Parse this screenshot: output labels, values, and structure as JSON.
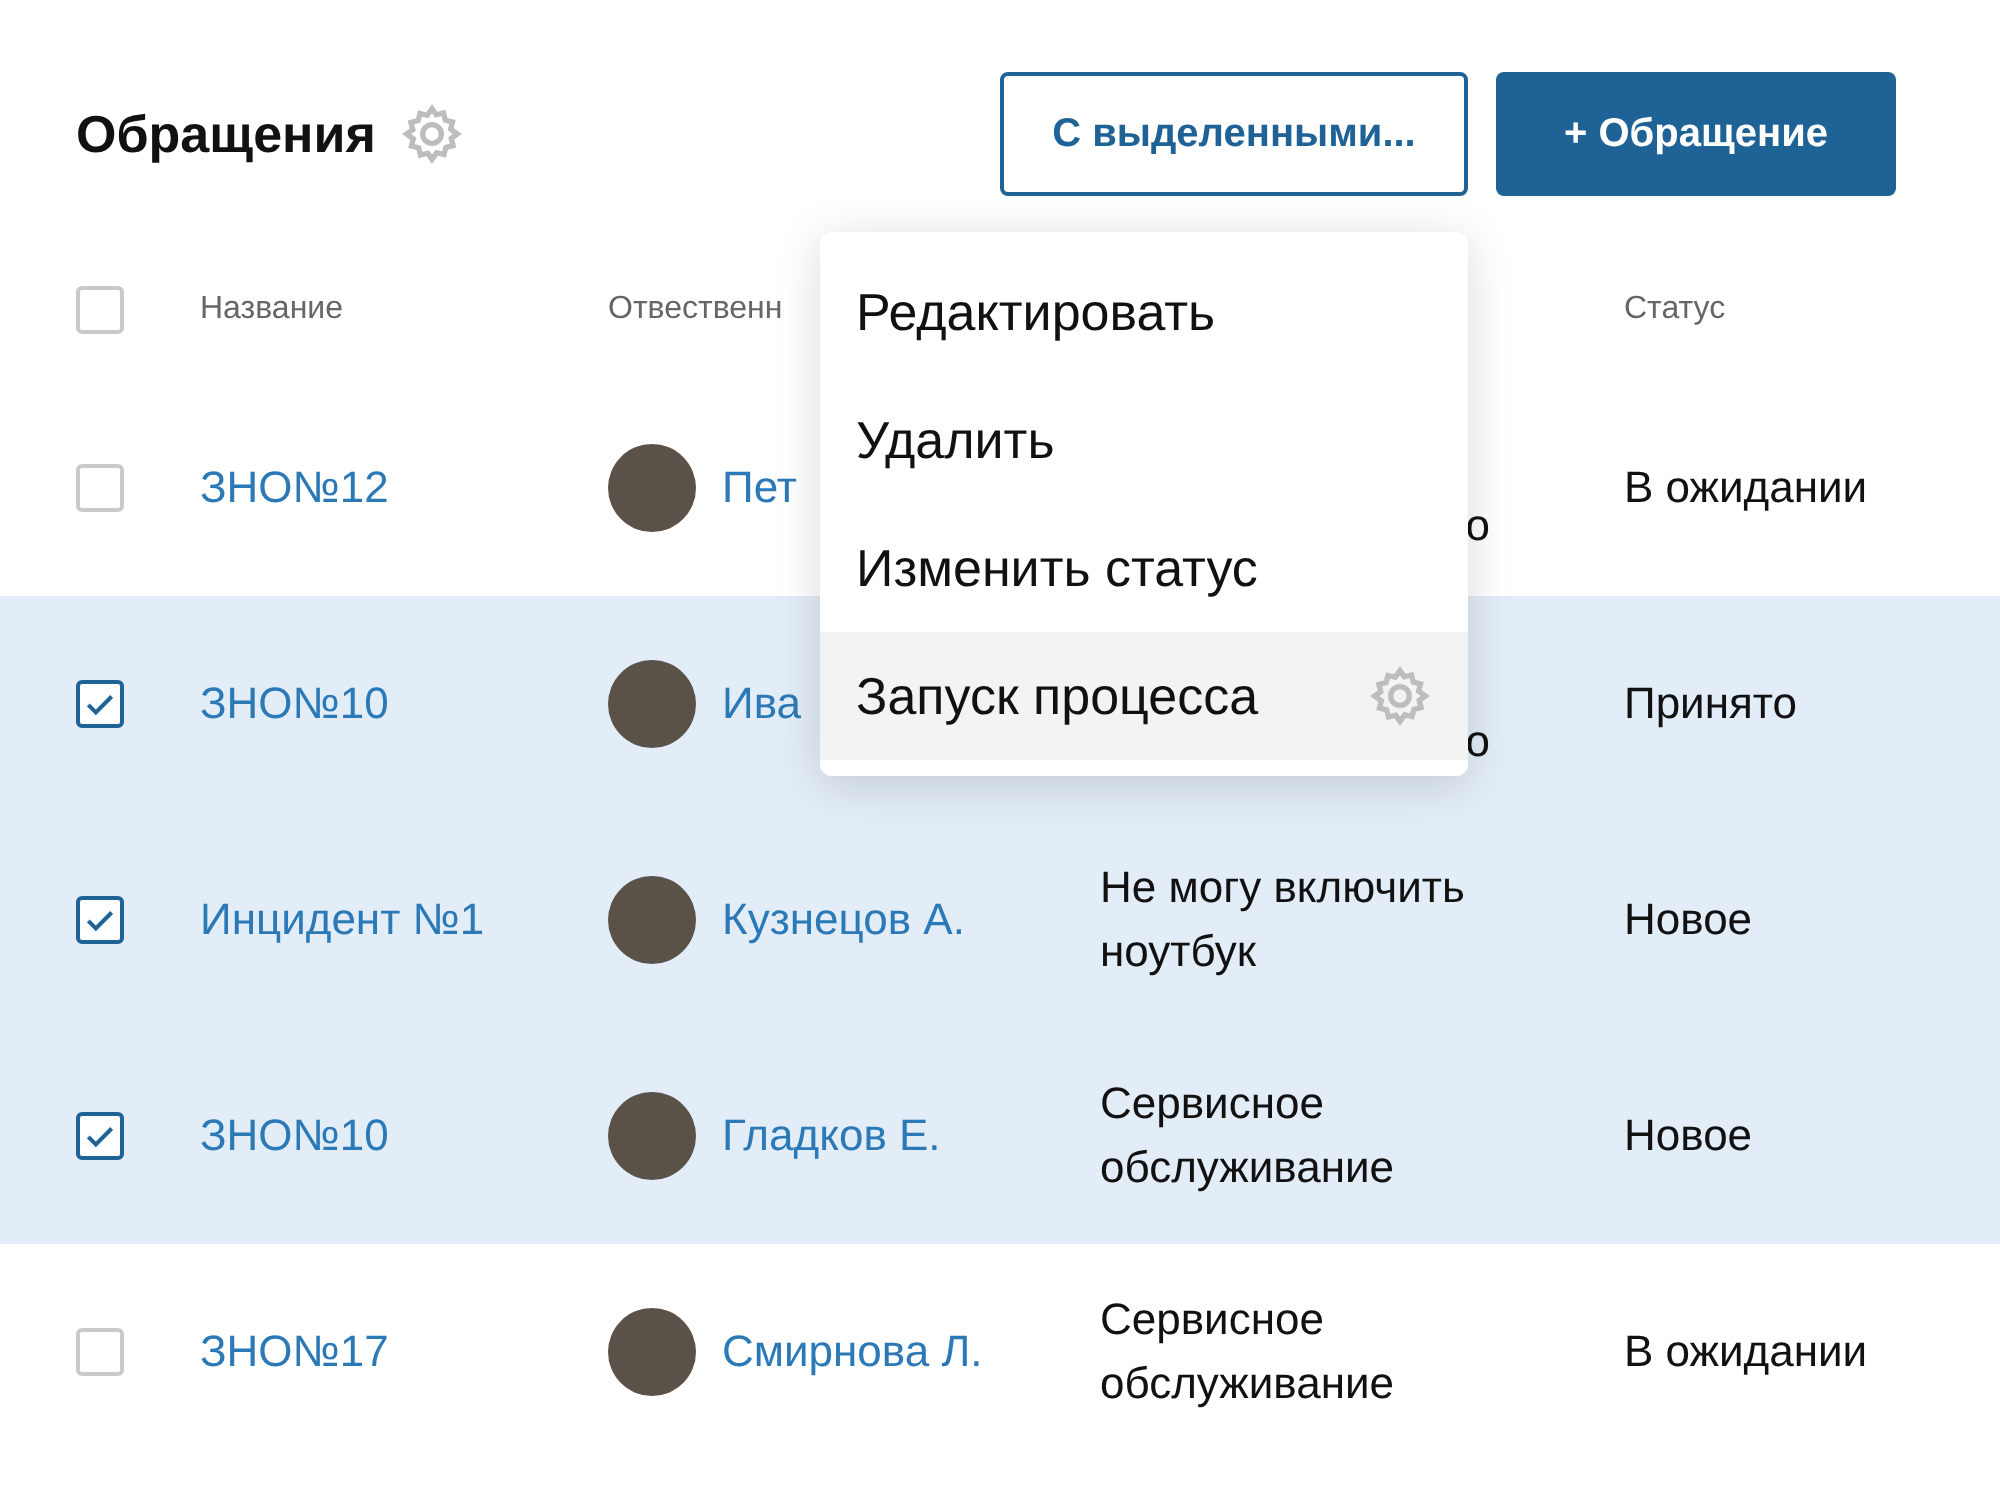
{
  "title": "Обращения",
  "buttons": [
    {
      "label": "С выделенными...",
      "kind": "outline"
    },
    {
      "label": "+ Обращение",
      "kind": "primary"
    }
  ],
  "table": {
    "header_checkbox": {
      "checked": false
    },
    "columns": [
      "Название",
      "Отвественн"
    ],
    "status_column": "Статус",
    "rows": [
      {
        "selected": false,
        "name": "ЗНО№12",
        "responsible": "Пет",
        "description": "о",
        "description_covered": true,
        "status": "В ожидании"
      },
      {
        "selected": true,
        "name": "ЗНО№10",
        "responsible": "Ива",
        "description": "о",
        "description_covered": true,
        "status": "Принято"
      },
      {
        "selected": true,
        "name": "Инцидент №1",
        "responsible": "Кузнецов А.",
        "description": "Не могу включить ноутбук",
        "description_covered": false,
        "status": "Новое"
      },
      {
        "selected": true,
        "name": "ЗНО№10",
        "responsible": "Гладков Е.",
        "description": "Сервисное обслуживание",
        "description_covered": false,
        "status": "Новое"
      },
      {
        "selected": false,
        "name": "ЗНО№17",
        "responsible": "Смирнова Л.",
        "description": "Сервисное обслуживание",
        "description_covered": false,
        "status": "В ожидании"
      }
    ]
  },
  "menu": {
    "items": [
      {
        "label": "Редактировать",
        "selected": false,
        "icon": false
      },
      {
        "label": "Удалить",
        "selected": false,
        "icon": false
      },
      {
        "label": "Изменить статус",
        "selected": false,
        "icon": false
      },
      {
        "label": "Запуск процесса",
        "selected": true,
        "icon": true
      }
    ]
  }
}
